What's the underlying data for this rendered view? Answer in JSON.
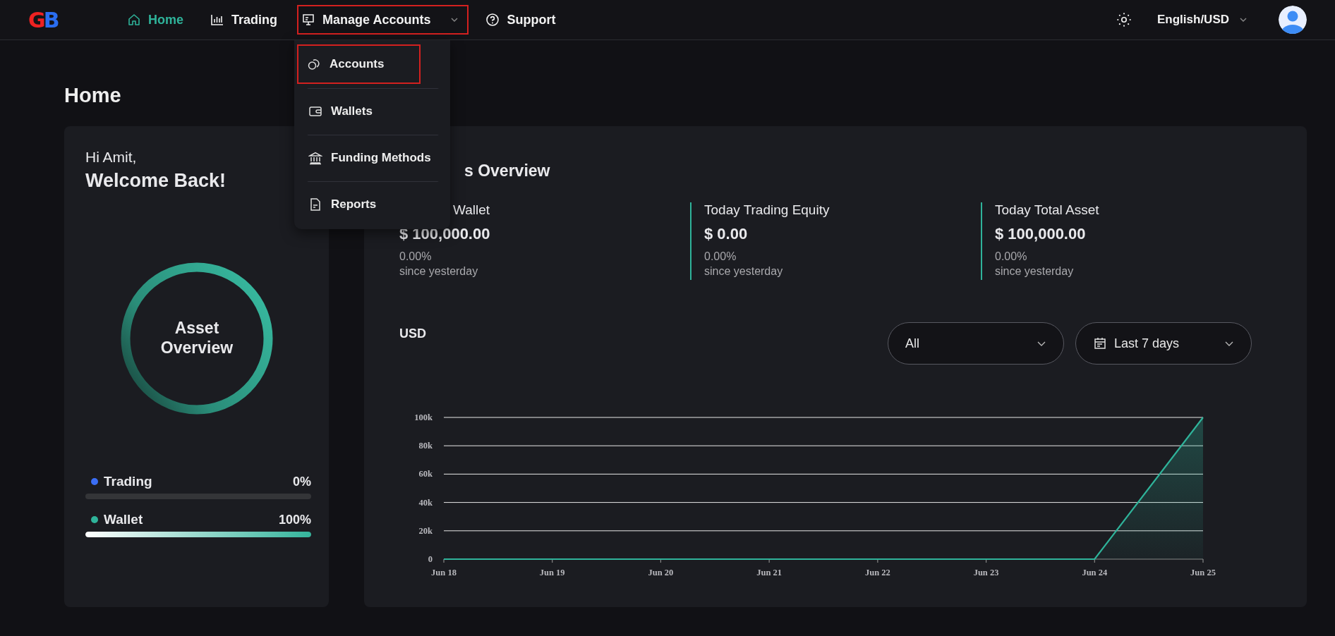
{
  "nav": {
    "logo": "GB",
    "items": [
      {
        "label": "Home",
        "selected": true,
        "dropdown": false,
        "outlined": false
      },
      {
        "label": "Trading",
        "selected": false,
        "dropdown": false,
        "outlined": false
      },
      {
        "label": "Manage Accounts",
        "selected": false,
        "dropdown": true,
        "outlined": true
      },
      {
        "label": "Support",
        "selected": false,
        "dropdown": false,
        "outlined": false
      }
    ],
    "language": "English/USD"
  },
  "menu": {
    "items": [
      {
        "label": "Accounts",
        "outlined": true
      },
      {
        "label": "Wallets",
        "outlined": false
      },
      {
        "label": "Funding Methods",
        "outlined": false
      },
      {
        "label": "Reports",
        "outlined": false
      }
    ]
  },
  "page_title": "Home",
  "greeting": {
    "hello": "Hi Amit,",
    "welcome": "Welcome Back!"
  },
  "asset_ring": {
    "label": "Asset Overview"
  },
  "allocation": [
    {
      "name": "Trading",
      "percent": "0%",
      "color": "#3b6ef5",
      "level": 0
    },
    {
      "name": "Wallet",
      "percent": "100%",
      "color": "#2fb39a",
      "level": 1
    }
  ],
  "overview": {
    "title": "s Overview",
    "stats": [
      {
        "label": "Wallet",
        "value": "$ 100,000.00",
        "change": "0.00%",
        "since": "since yesterday"
      },
      {
        "label": "Today Trading Equity",
        "value": "$ 0.00",
        "change": "0.00%",
        "since": "since yesterday"
      },
      {
        "label": "Today Total Asset",
        "value": "$ 100,000.00",
        "change": "0.00%",
        "since": "since yesterday"
      }
    ],
    "currency_label": "USD",
    "filters": [
      {
        "value": "All",
        "kind": "plain"
      },
      {
        "value": "Last 7 days",
        "kind": "date"
      }
    ],
    "chart_data": {
      "type": "area",
      "categories": [
        "Jun 18",
        "Jun 19",
        "Jun 20",
        "Jun 21",
        "Jun 22",
        "Jun 23",
        "Jun 24",
        "Jun 25"
      ],
      "series": [
        {
          "color": "#2fb39a",
          "values": [
            0,
            0,
            0,
            0,
            0,
            0,
            0,
            100000
          ]
        }
      ],
      "ylim": [
        0,
        100000
      ],
      "grid": true,
      "yticks": [
        {
          "value": 0,
          "label": "0"
        },
        {
          "value": 20000,
          "label": "20k"
        },
        {
          "value": 40000,
          "label": "40k"
        },
        {
          "value": 60000,
          "label": "60k"
        },
        {
          "value": 80000,
          "label": "80k"
        },
        {
          "value": 100000,
          "label": "100k"
        }
      ]
    }
  }
}
